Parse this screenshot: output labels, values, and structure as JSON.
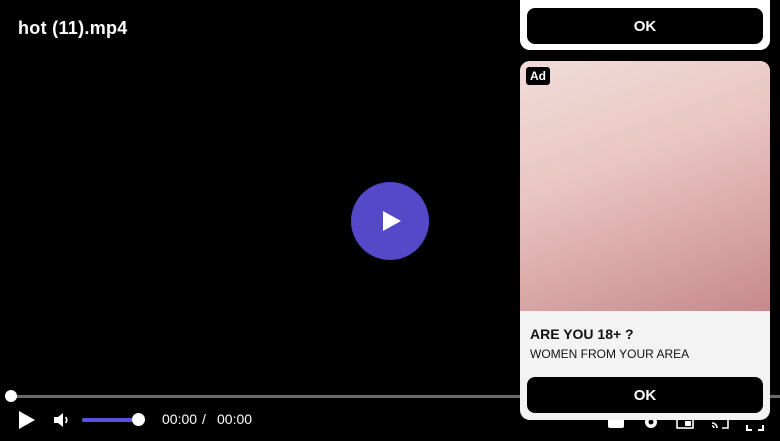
{
  "video": {
    "title": "hot (11).mp4",
    "progress": 0,
    "volume": 0.9,
    "time_current": "00:00",
    "time_separator": "/",
    "time_duration": "00:00"
  },
  "icons": {
    "big_play": "play-icon",
    "play": "play-icon",
    "mute": "volume-icon",
    "subtitles": "subtitles-icon",
    "settings": "gear-icon",
    "pip": "picture-in-picture-icon",
    "cast": "cast-icon",
    "fullscreen": "fullscreen-icon"
  },
  "colors": {
    "accent": "#5548c9",
    "volume_fill": "#5a52e0",
    "background": "#000000",
    "button_dark": "#000000"
  },
  "popup_top": {
    "ok_label": "OK"
  },
  "ad": {
    "badge": "Ad",
    "headline": "ARE YOU 18+ ?",
    "subtext": "WOMEN FROM YOUR AREA",
    "ok_label": "OK"
  }
}
